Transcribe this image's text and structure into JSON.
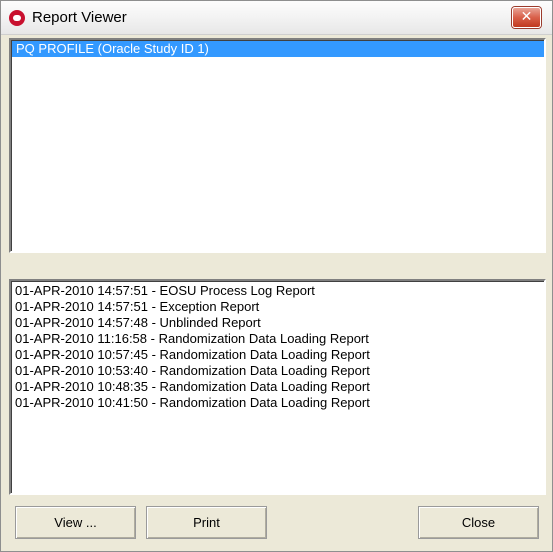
{
  "window": {
    "title": "Report Viewer",
    "close_glyph": "✕"
  },
  "studies": {
    "items": [
      {
        "label": "PQ PROFILE (Oracle Study ID 1)",
        "selected": true
      }
    ]
  },
  "reports": {
    "items": [
      "01-APR-2010 14:57:51 - EOSU Process Log Report",
      "01-APR-2010 14:57:51 - Exception Report",
      "01-APR-2010 14:57:48 - Unblinded Report",
      "01-APR-2010 11:16:58 - Randomization Data Loading Report",
      "01-APR-2010 10:57:45 - Randomization Data Loading Report",
      "01-APR-2010 10:53:40 - Randomization Data Loading Report",
      "01-APR-2010 10:48:35 - Randomization Data Loading Report",
      "01-APR-2010 10:41:50 - Randomization Data Loading Report"
    ]
  },
  "buttons": {
    "view": {
      "mnemonic": "V",
      "rest": "iew ..."
    },
    "print": {
      "mnemonic": "P",
      "rest": "rint"
    },
    "close": {
      "mnemonic": "C",
      "rest": "lose"
    }
  },
  "colors": {
    "selection": "#3399ff",
    "window_bg": "#ece9d8",
    "close_button": "#d9604a"
  },
  "icons": {
    "app": "oracle-logo-icon",
    "close": "close-icon"
  }
}
